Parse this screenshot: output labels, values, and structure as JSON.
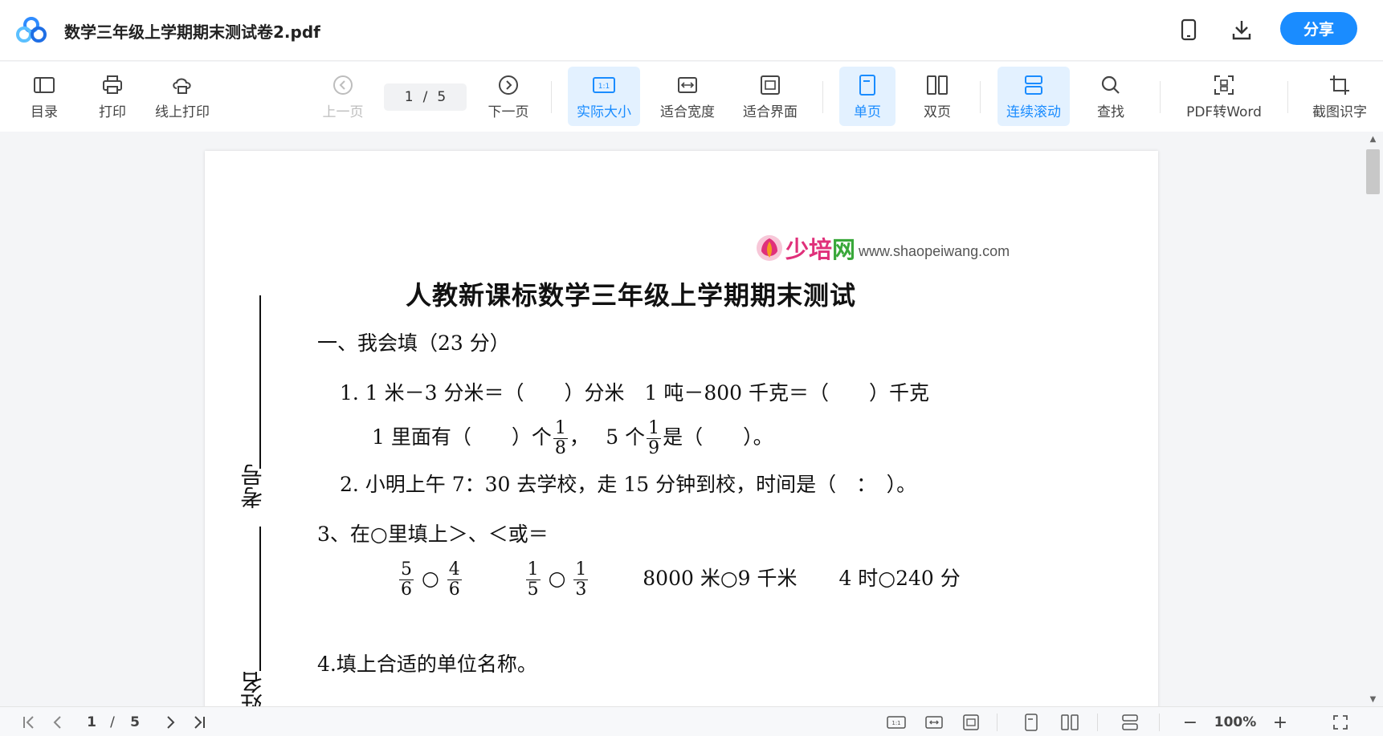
{
  "app": {
    "doc_title": "数学三年级上学期期末测试卷2.pdf",
    "share_label": "分享",
    "accent_color": "#1a8cff"
  },
  "toolbar": {
    "toc_label": "目录",
    "print_label": "打印",
    "online_print_label": "线上打印",
    "prev_label": "上一页",
    "page_current": "1",
    "page_sep": "/",
    "page_total": "5",
    "next_label": "下一页",
    "actual_size_label": "实际大小",
    "fit_width_label": "适合宽度",
    "fit_window_label": "适合界面",
    "single_page_label": "单页",
    "double_page_label": "双页",
    "continuous_label": "连续滚动",
    "find_label": "查找",
    "pdf_to_word_label": "PDF转Word",
    "ocr_label": "截图识字"
  },
  "document": {
    "watermark_cn_1": "少培",
    "watermark_cn_2": "网",
    "watermark_url": "www.shaopeiwang.com",
    "title": "人教新课标数学三年级上学期期末测试",
    "section1": "一、我会填（23 分）",
    "q1a": "1. 1 米－3 分米＝（　　）分米　1 吨－800 千克＝（　　）千克",
    "q1b_pre": "1 里面有（　　）个",
    "q1b_mid": "，　 5 个",
    "q1b_post": "是（　　）。",
    "frac_1_8": {
      "num": "1",
      "den": "8"
    },
    "frac_1_9": {
      "num": "1",
      "den": "9"
    },
    "q2": "2. 小明上午 7：30 去学校，走 15 分钟到校，时间是（　：　）。",
    "q3": "3、在○里填上＞、＜或＝",
    "q3_f1": {
      "num": "5",
      "den": "6"
    },
    "q3_f2": {
      "num": "4",
      "den": "6"
    },
    "q3_f3": {
      "num": "1",
      "den": "5"
    },
    "q3_f4": {
      "num": "1",
      "den": "3"
    },
    "circle": "○",
    "q3_item3": "8000 米○9 千米",
    "q3_item4": "4 时○240 分",
    "q4": "4.填上合适的单位名称。",
    "side_exam_no": "考号",
    "side_name": "姓名"
  },
  "bottombar": {
    "page_current": "1",
    "page_sep": "/",
    "page_total": "5",
    "zoom_label": "100%",
    "zoom_out": "−",
    "zoom_in": "+"
  }
}
